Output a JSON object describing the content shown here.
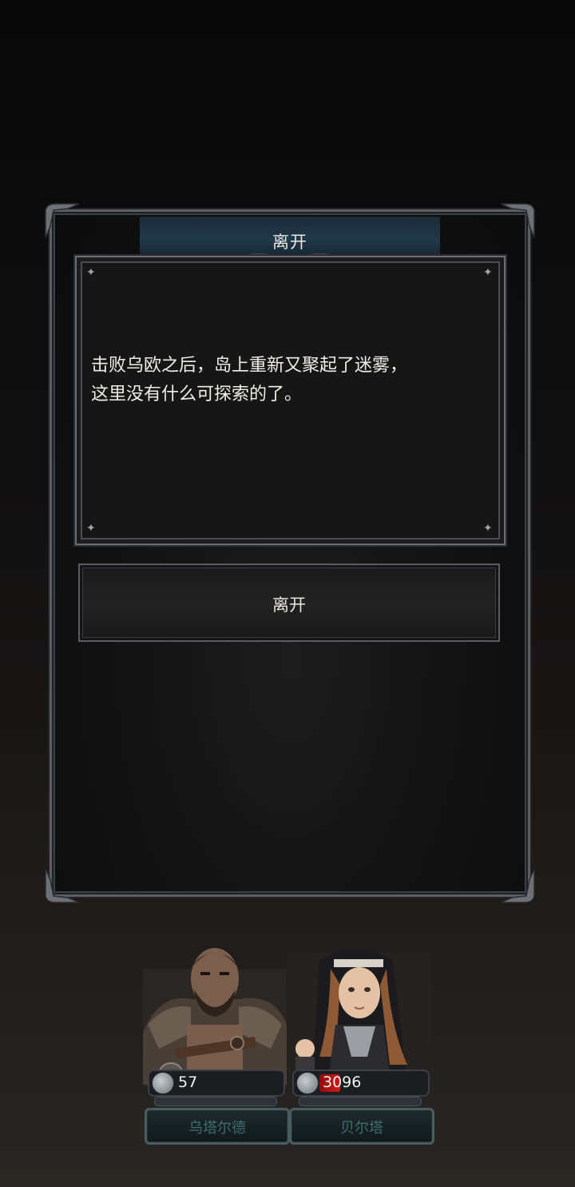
{
  "dialog": {
    "title": "离开",
    "message_lines": [
      "击败乌欧之后，岛上重新又聚起了迷雾，",
      "这里没有什么可探索的了。"
    ],
    "button_label": "离开"
  },
  "party": [
    {
      "name": "乌塔尔德",
      "hp": "57",
      "hp_fill_fraction": 0.0,
      "portrait": "bearded-warrior-portrait"
    },
    {
      "name": "贝尔塔",
      "hp": "3096",
      "hp_fill_fraction": 0.2,
      "portrait": "nun-fighter-portrait"
    }
  ],
  "colors": {
    "title_bar": "#21394a",
    "frame": "#5c5e63",
    "hp_fill": "#d11a1a",
    "name_text": "#3f6d6f"
  }
}
